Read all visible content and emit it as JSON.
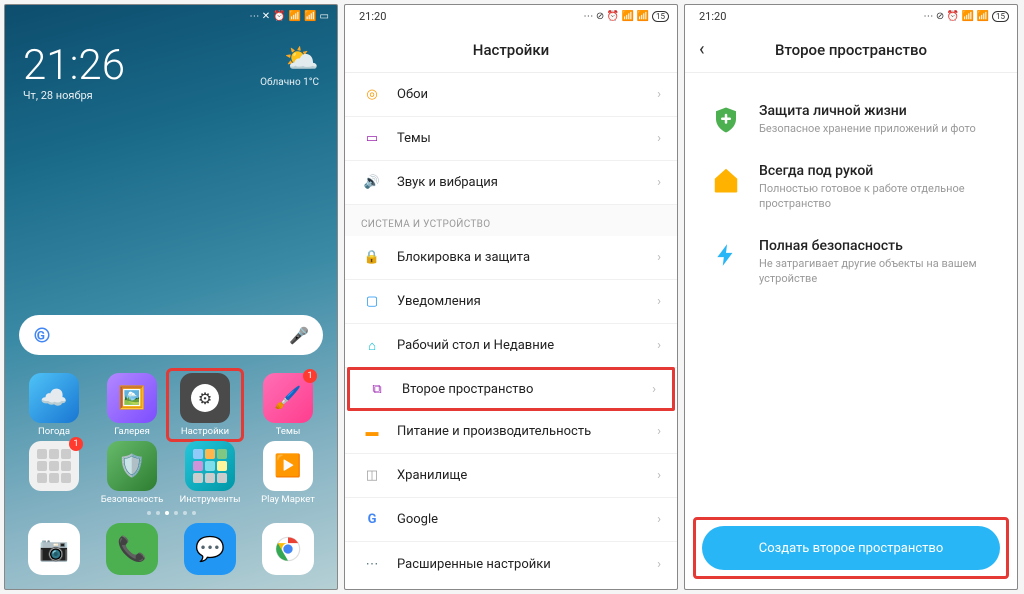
{
  "phone1": {
    "status_time_hidden": "",
    "clock": {
      "time": "21:26",
      "date": "Чт, 28 ноября"
    },
    "weather": {
      "cond": "Облачно  1°C"
    },
    "apps_row1": [
      {
        "label": "Погода"
      },
      {
        "label": "Галерея"
      },
      {
        "label": "Настройки"
      },
      {
        "label": "Темы",
        "badge": "1"
      }
    ],
    "apps_row2": [
      {
        "label": "",
        "badge": "1"
      },
      {
        "label": "Безопасность"
      },
      {
        "label": "Инструменты"
      },
      {
        "label": "Play Маркет"
      }
    ]
  },
  "phone2": {
    "status_time": "21:20",
    "title": "Настройки",
    "items_top": [
      {
        "label": "Обои"
      },
      {
        "label": "Темы"
      },
      {
        "label": "Звук и вибрация"
      }
    ],
    "section": "СИСТЕМА И УСТРОЙСТВО",
    "items_sys": [
      {
        "label": "Блокировка и защита"
      },
      {
        "label": "Уведомления"
      },
      {
        "label": "Рабочий стол и Недавние"
      },
      {
        "label": "Второе пространство"
      },
      {
        "label": "Питание и производительность"
      },
      {
        "label": "Хранилище"
      },
      {
        "label": "Google"
      },
      {
        "label": "Расширенные настройки"
      }
    ]
  },
  "phone3": {
    "status_time": "21:20",
    "title": "Второе пространство",
    "features": [
      {
        "title": "Защита личной жизни",
        "desc": "Безопасное хранение приложений и фото"
      },
      {
        "title": "Всегда под рукой",
        "desc": "Полностью готовое к работе отдельное пространство"
      },
      {
        "title": "Полная безопасность",
        "desc": "Не затрагивает другие объекты на вашем устройстве"
      }
    ],
    "cta": "Создать второе пространство"
  },
  "battery_label": "15"
}
